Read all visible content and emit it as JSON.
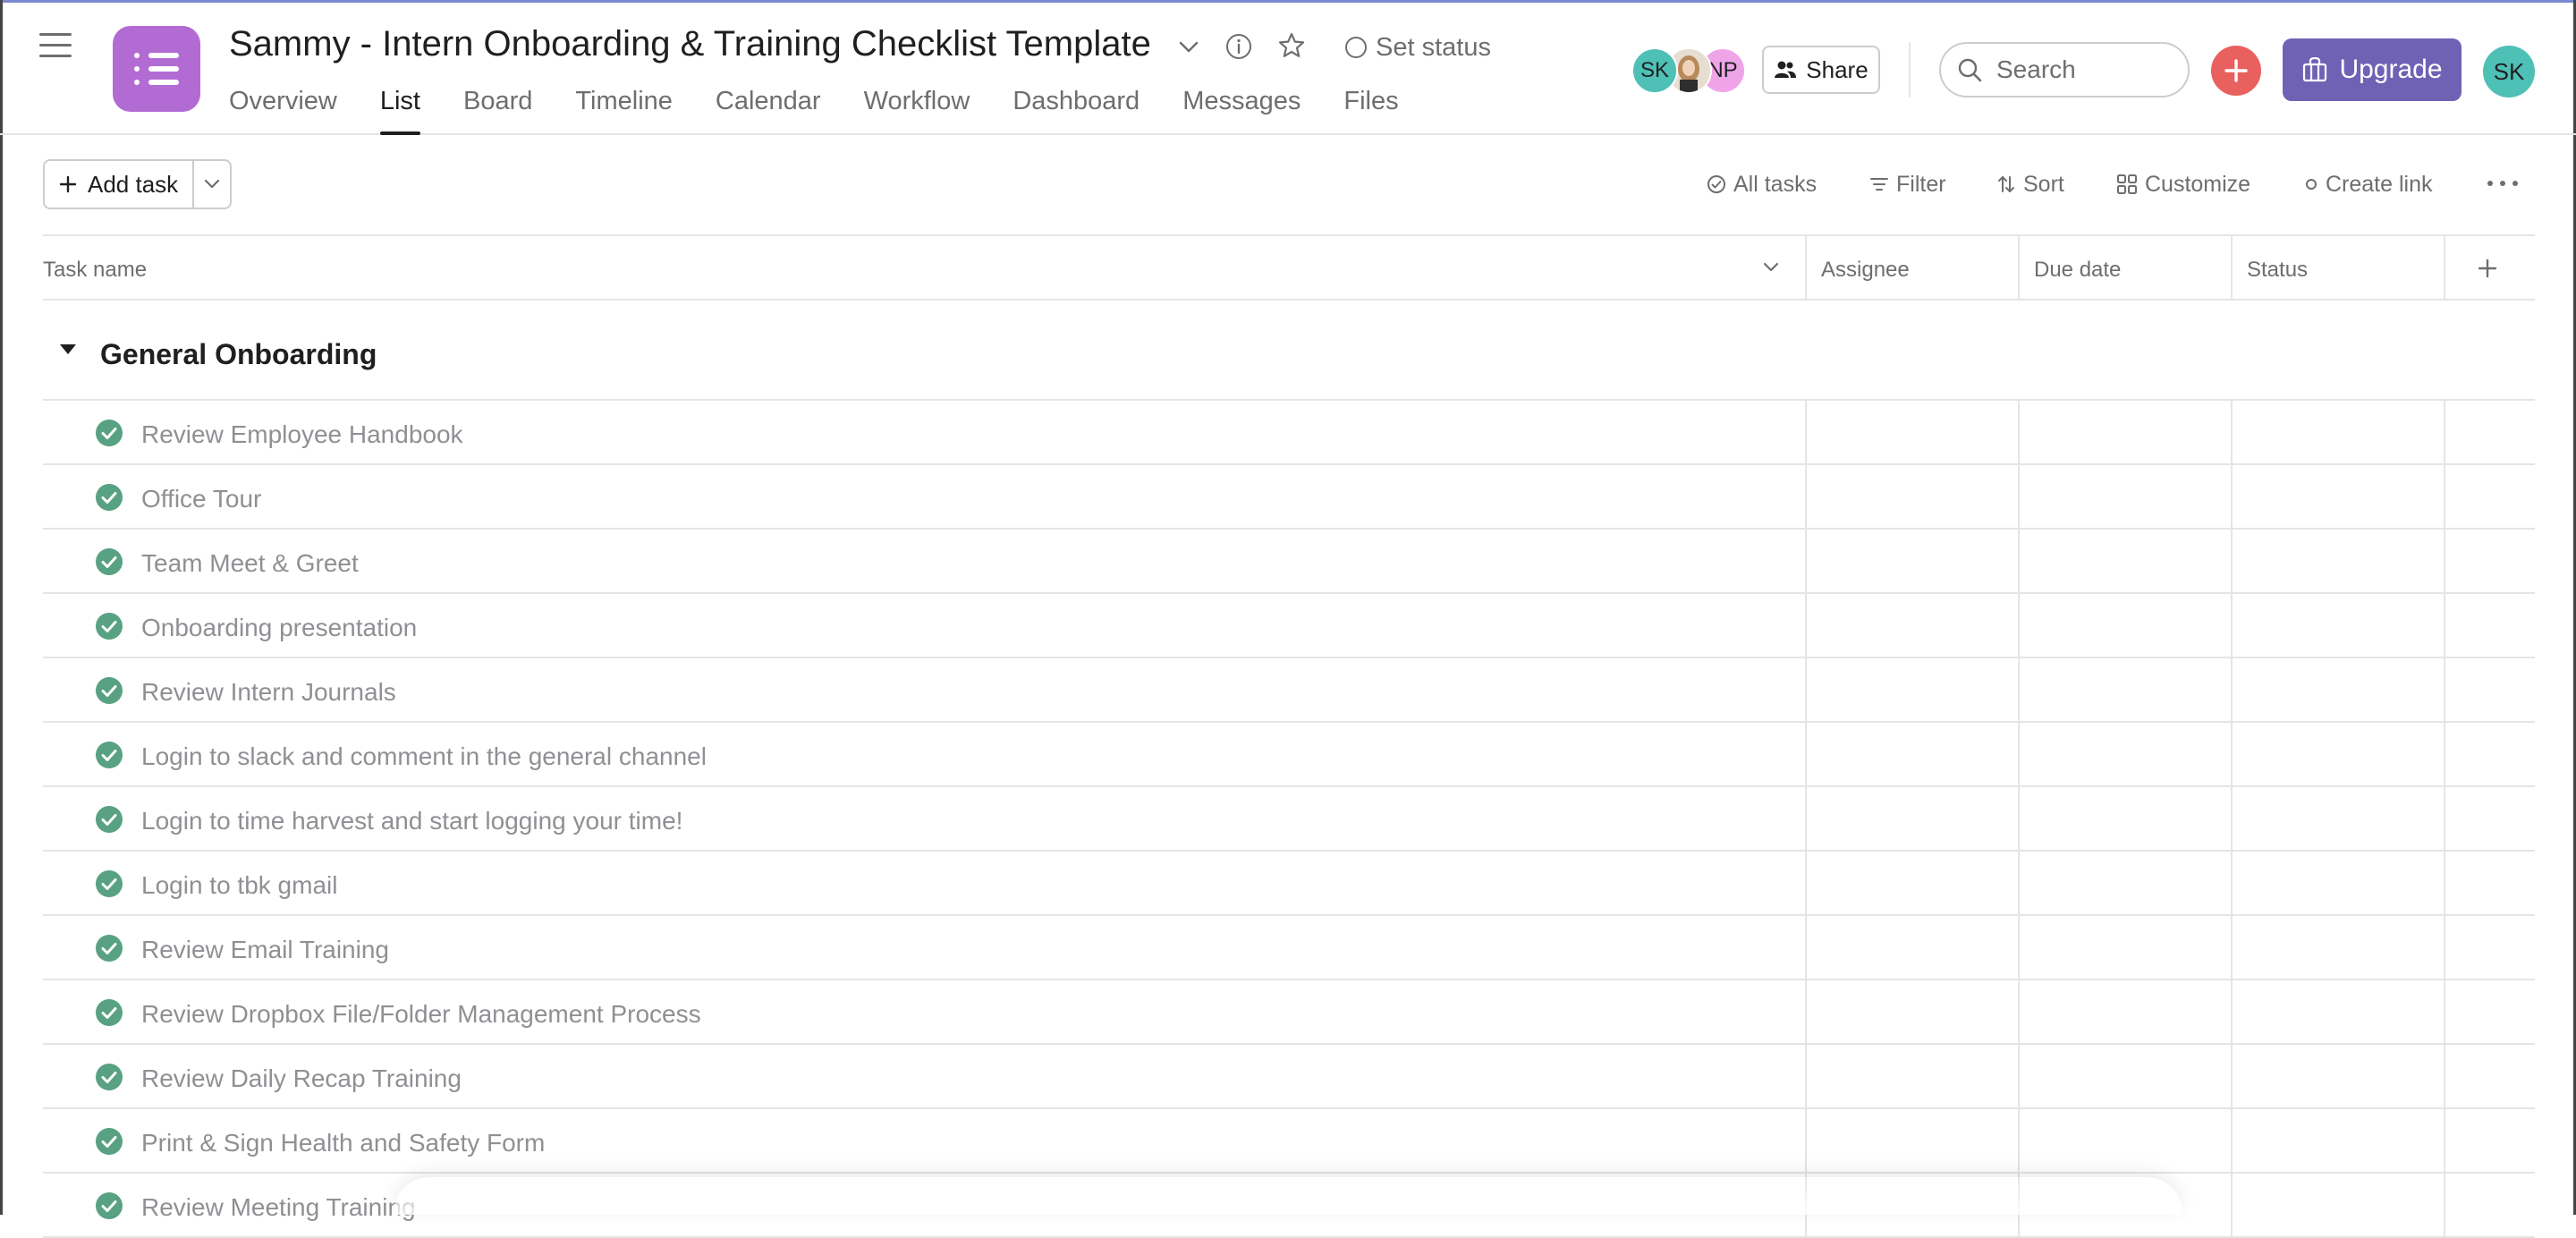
{
  "project": {
    "title": "Sammy - Intern Onboarding & Training Checklist Template",
    "set_status_label": "Set status",
    "icon_color": "#b36bd4"
  },
  "tabs": [
    {
      "label": "Overview",
      "active": false
    },
    {
      "label": "List",
      "active": true
    },
    {
      "label": "Board",
      "active": false
    },
    {
      "label": "Timeline",
      "active": false
    },
    {
      "label": "Calendar",
      "active": false
    },
    {
      "label": "Workflow",
      "active": false
    },
    {
      "label": "Dashboard",
      "active": false
    },
    {
      "label": "Messages",
      "active": false
    },
    {
      "label": "Files",
      "active": false
    }
  ],
  "members": [
    {
      "initials": "SK",
      "color": "#4ec0b6"
    },
    {
      "initials": "",
      "color": "#c9a98a",
      "type": "photo"
    },
    {
      "initials": "NP",
      "color": "#f0a4e8"
    }
  ],
  "header_actions": {
    "share_label": "Share",
    "search_placeholder": "Search",
    "upgrade_label": "Upgrade",
    "user_initials": "SK",
    "add_color": "#e8615f",
    "upgrade_color": "#6f62b5"
  },
  "toolbar": {
    "add_task_label": "Add task",
    "all_tasks_label": "All tasks",
    "filter_label": "Filter",
    "sort_label": "Sort",
    "customize_label": "Customize",
    "create_link_label": "Create link"
  },
  "columns": {
    "task_name": "Task name",
    "assignee": "Assignee",
    "due_date": "Due date",
    "status": "Status"
  },
  "section": {
    "title": "General Onboarding"
  },
  "tasks": [
    {
      "name": "Review Employee Handbook",
      "completed": true
    },
    {
      "name": "Office Tour",
      "completed": true
    },
    {
      "name": "Team Meet & Greet",
      "completed": true
    },
    {
      "name": "Onboarding presentation",
      "completed": true
    },
    {
      "name": "Review Intern Journals",
      "completed": true
    },
    {
      "name": "Login to slack and comment in the general channel",
      "completed": true
    },
    {
      "name": "Login to time harvest and start logging your time!",
      "completed": true
    },
    {
      "name": "Login to tbk gmail",
      "completed": true
    },
    {
      "name": "Review Email Training",
      "completed": true
    },
    {
      "name": "Review Dropbox File/Folder Management Process",
      "completed": true
    },
    {
      "name": "Review Daily Recap Training",
      "completed": true
    },
    {
      "name": "Print & Sign Health and Safety Form",
      "completed": true
    },
    {
      "name": "Review Meeting Training",
      "completed": true
    }
  ],
  "colors": {
    "complete_green": "#58a182",
    "muted_text": "#8f9094"
  }
}
